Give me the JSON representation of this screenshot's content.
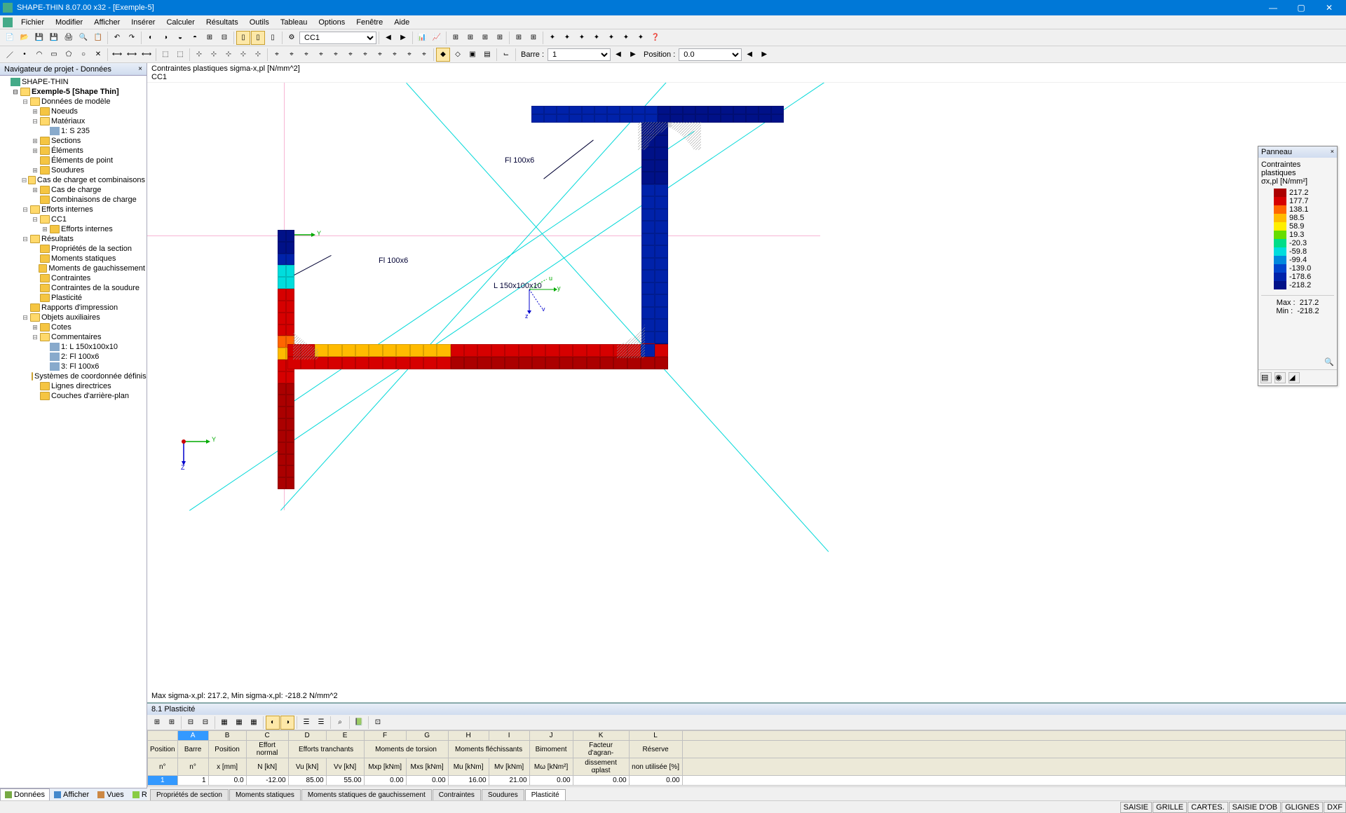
{
  "title": "SHAPE-THIN 8.07.00 x32 - [Exemple-5]",
  "menu": [
    "Fichier",
    "Modifier",
    "Afficher",
    "Insérer",
    "Calculer",
    "Résultats",
    "Outils",
    "Tableau",
    "Options",
    "Fenêtre",
    "Aide"
  ],
  "toolbar2": {
    "dropdown_cc": "CC1",
    "barre_label": "Barre :",
    "barre_value": "1",
    "position_label": "Position :",
    "position_value": "0.0"
  },
  "navigator": {
    "title": "Navigateur de projet - Données",
    "root": "SHAPE-THIN",
    "project": "Exemple-5 [Shape Thin]",
    "nodes": {
      "model_data": "Données de modèle",
      "noeuds": "Noeuds",
      "materiaux": "Matériaux",
      "mat1": "1: S 235",
      "sections": "Sections",
      "elements": "Éléments",
      "elements_point": "Éléments de point",
      "soudures": "Soudures",
      "cas_charge": "Cas de charge et combinaisons",
      "cas_de_charge": "Cas de charge",
      "combis": "Combinaisons de charge",
      "efforts": "Efforts internes",
      "cc1": "CC1",
      "efforts_internes": "Efforts internes",
      "resultats": "Résultats",
      "prop_section": "Propriétés de la section",
      "moments_stat": "Moments statiques",
      "moments_gauch": "Moments de gauchissement",
      "contraintes": "Contraintes",
      "contraintes_soud": "Contraintes de la soudure",
      "plasticite": "Plasticité",
      "rapports": "Rapports d'impression",
      "objets_aux": "Objets auxiliaires",
      "cotes": "Cotes",
      "commentaires": "Commentaires",
      "comm1": "1: L 150x100x10",
      "comm2": "2: Fl 100x6",
      "comm3": "3: Fl 100x6",
      "sys_coord": "Systèmes de coordonnée définis par l",
      "lignes_dir": "Lignes directrices",
      "couches": "Couches d'arrière-plan"
    }
  },
  "canvas": {
    "header_line1": "Contraintes plastiques sigma-x,pl [N/mm^2]",
    "header_line2": "CC1",
    "label_fl1": "Fl 100x6",
    "label_fl2": "Fl 100x6",
    "label_l": "L 150x100x10",
    "axis_y": "Y",
    "axis_z": "Z",
    "axis_y2": "y",
    "axis_z2": "z",
    "axis_u": "u",
    "axis_v": "v",
    "footer": "Max sigma-x,pl: 217.2, Min sigma-x,pl: -218.2 N/mm^2"
  },
  "legend": {
    "title": "Panneau",
    "sub1": "Contraintes plastiques",
    "sub2": "σx,pl [N/mm²]",
    "values": [
      "217.2",
      "177.7",
      "138.1",
      "98.5",
      "58.9",
      "19.3",
      "-20.3",
      "-59.8",
      "-99.4",
      "-139.0",
      "-178.6",
      "-218.2"
    ],
    "max_label": "Max :",
    "max_value": "217.2",
    "min_label": "Min :",
    "min_value": "-218.2"
  },
  "bottom": {
    "title": "8.1 Plasticité",
    "col_letters": [
      "A",
      "B",
      "C",
      "D",
      "E",
      "F",
      "G",
      "H",
      "I",
      "J",
      "K",
      "L"
    ],
    "headers_grp": {
      "position": "Position",
      "barre": "Barre",
      "position2": "Position",
      "effort_normal": "Effort normal",
      "efforts_tranch": "Efforts tranchants",
      "moments_torsion": "Moments de torsion",
      "moments_flech": "Moments fléchissants",
      "bimoment": "Bimoment",
      "facteur": "Facteur d'agran-",
      "reserve": "Réserve"
    },
    "headers_sub": {
      "n": "n°",
      "n2": "n°",
      "x": "x [mm]",
      "N": "N [kN]",
      "Vu": "Vu [kN]",
      "Vv": "Vv [kN]",
      "Mxp": "Mxp [kNm]",
      "Mxs": "Mxs [kNm]",
      "Mu": "Mu [kNm]",
      "Mv": "Mv [kNm]",
      "Mw": "Mω [kNm²]",
      "alpha": "dissement αplast",
      "reserve": "non utilisée [%]"
    },
    "row1": {
      "pos": "1",
      "barre": "1",
      "x": "0.0",
      "N": "-12.00",
      "Vu": "85.00",
      "Vv": "55.00",
      "Mxp": "0.00",
      "Mxs": "0.00",
      "Mu": "16.00",
      "Mv": "21.00",
      "Mw": "0.00",
      "alpha": "0.00",
      "reserve": "0.00"
    },
    "tabs": [
      "Propriétés de section",
      "Moments statiques",
      "Moments statiques de gauchissement",
      "Contraintes",
      "Soudures",
      "Plasticité"
    ]
  },
  "viewtabs": {
    "donnees": "Données",
    "afficher": "Afficher",
    "vues": "Vues",
    "resultats": "Résultats"
  },
  "status": {
    "items": [
      "SAISIE",
      "GRILLE",
      "CARTES.",
      "SAISIE D'OB",
      "GLIGNES",
      "DXF"
    ]
  }
}
